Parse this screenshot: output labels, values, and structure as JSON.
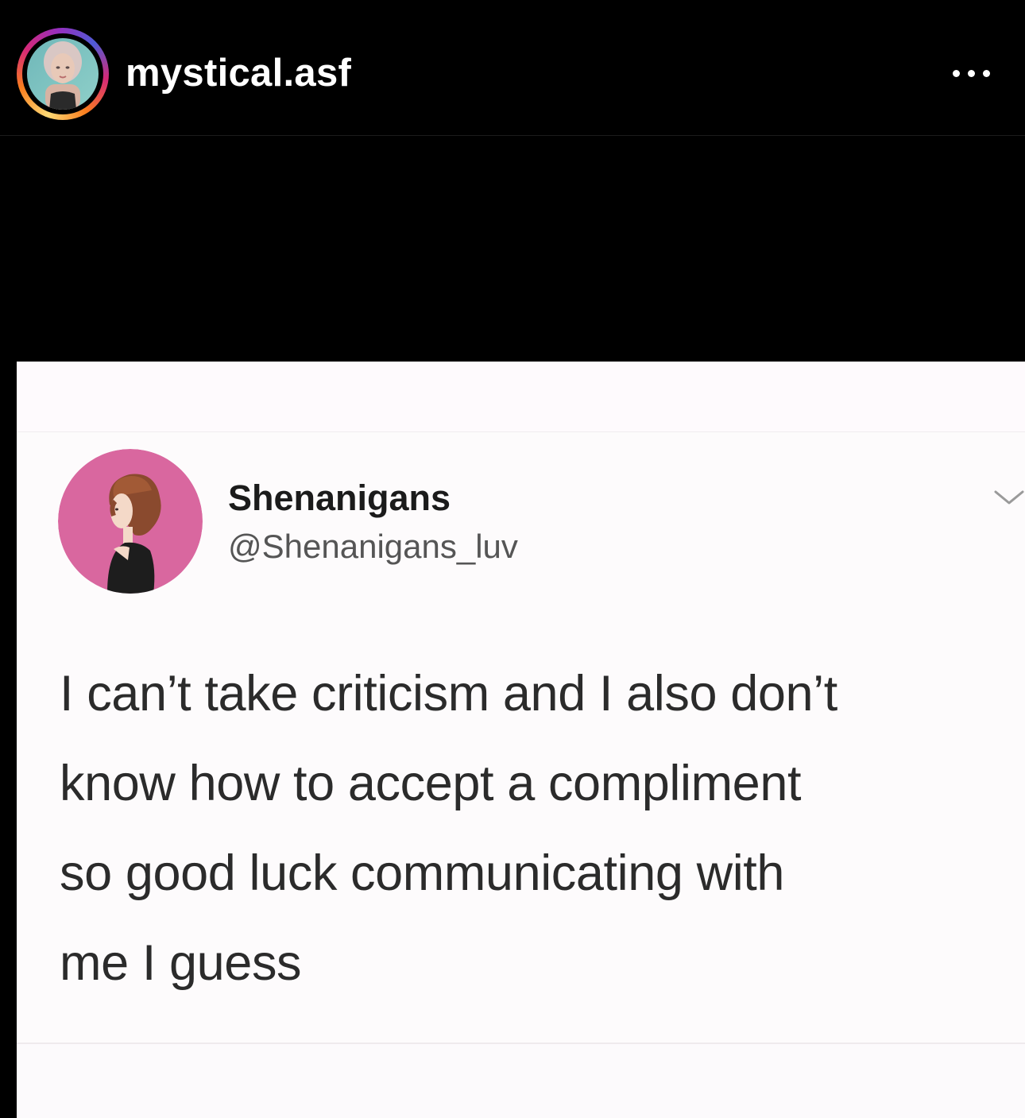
{
  "header": {
    "username": "mystical.asf",
    "story_ring_colors": [
      "#feda75",
      "#fa7e1e",
      "#d62976",
      "#962fbf",
      "#4f5bd5"
    ],
    "more_icon": "more-horizontal-icon"
  },
  "tweet": {
    "display_name": "Shenanigans",
    "handle": "@Shenanigans_luv",
    "text_lines": [
      "I can’t take criticism and I also don’t",
      "know how to accept a compliment",
      "so good luck communicating with",
      "me I guess"
    ],
    "avatar_bg": "#d9679f",
    "menu_icon": "chevron-down-icon"
  }
}
